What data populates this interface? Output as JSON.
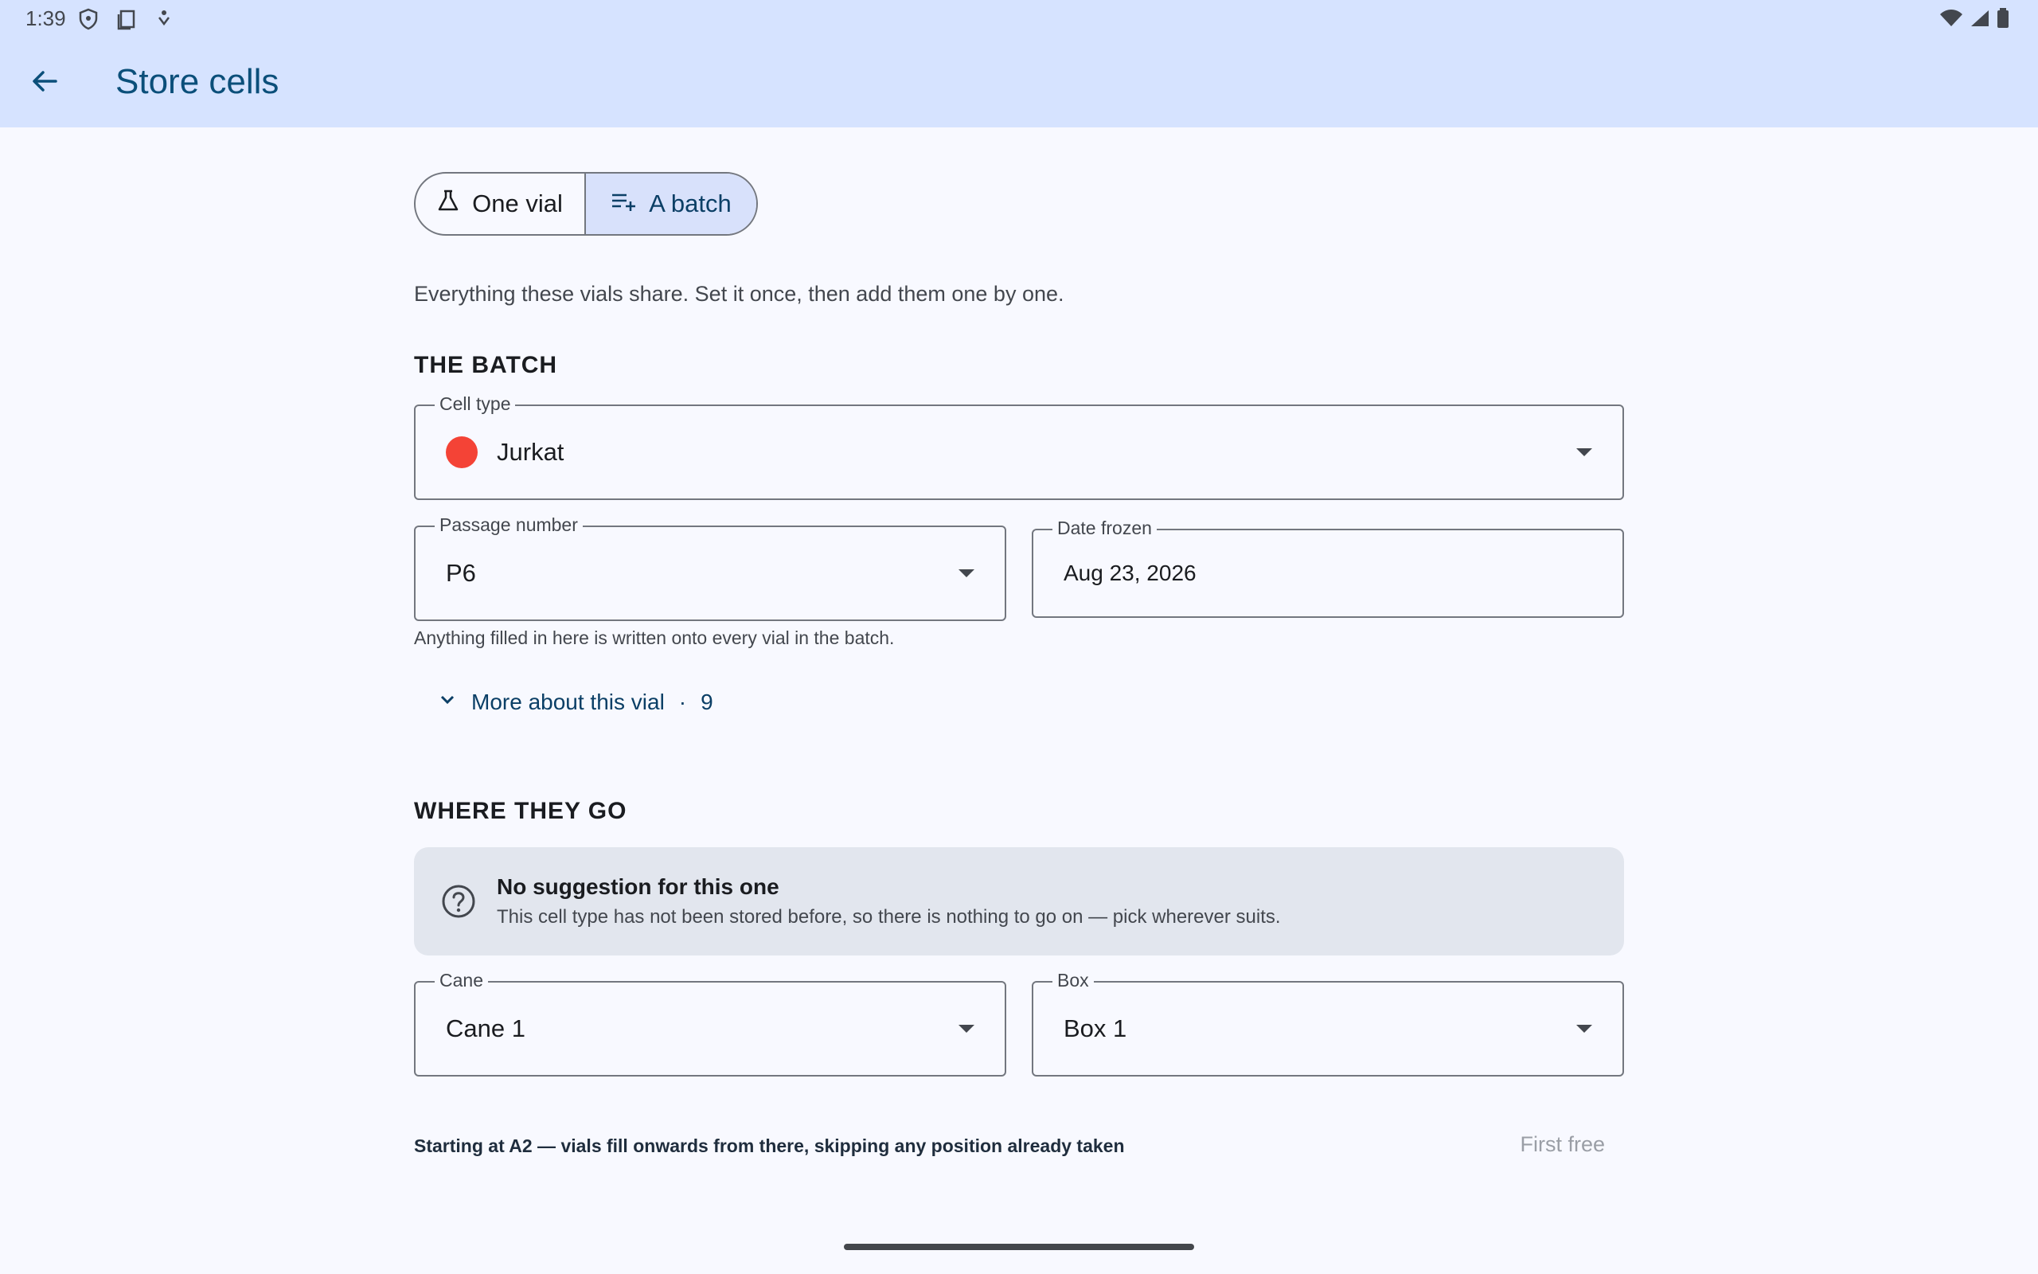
{
  "status_bar": {
    "time": "1:39"
  },
  "app_bar": {
    "title": "Store cells"
  },
  "mode_toggle": {
    "one_vial_label": "One vial",
    "batch_label": "A batch",
    "selected": "A batch"
  },
  "intro_text": "Everything these vials share. Set it once, then add them one by one.",
  "batch_section": {
    "heading": "THE BATCH",
    "cell_type": {
      "label": "Cell type",
      "value": "Jurkat",
      "color": "#f44336"
    },
    "passage_number": {
      "label": "Passage number",
      "value": "P6"
    },
    "date_frozen": {
      "label": "Date frozen",
      "value": "Aug 23, 2026"
    },
    "helper_text": "Anything filled in here is written onto every vial in the batch.",
    "more_link": {
      "label": "More about this vial",
      "separator": "·",
      "count": "9"
    }
  },
  "location_section": {
    "heading": "WHERE THEY GO",
    "suggestion": {
      "title": "No suggestion for this one",
      "body": "This cell type has not been stored before, so there is nothing to go on — pick wherever suits."
    },
    "cane": {
      "label": "Cane",
      "value": "Cane 1"
    },
    "box": {
      "label": "Box",
      "value": "Box 1"
    },
    "start_note": "Starting at A2 — vials fill onwards from there, skipping any position already taken",
    "first_free_label": "First free"
  },
  "colors": {
    "app_bar_bg": "#d6e3ff",
    "accent": "#0b4f7a",
    "selected_segment_bg": "#d8e1fb",
    "cell_type_dot": "#f44336"
  }
}
